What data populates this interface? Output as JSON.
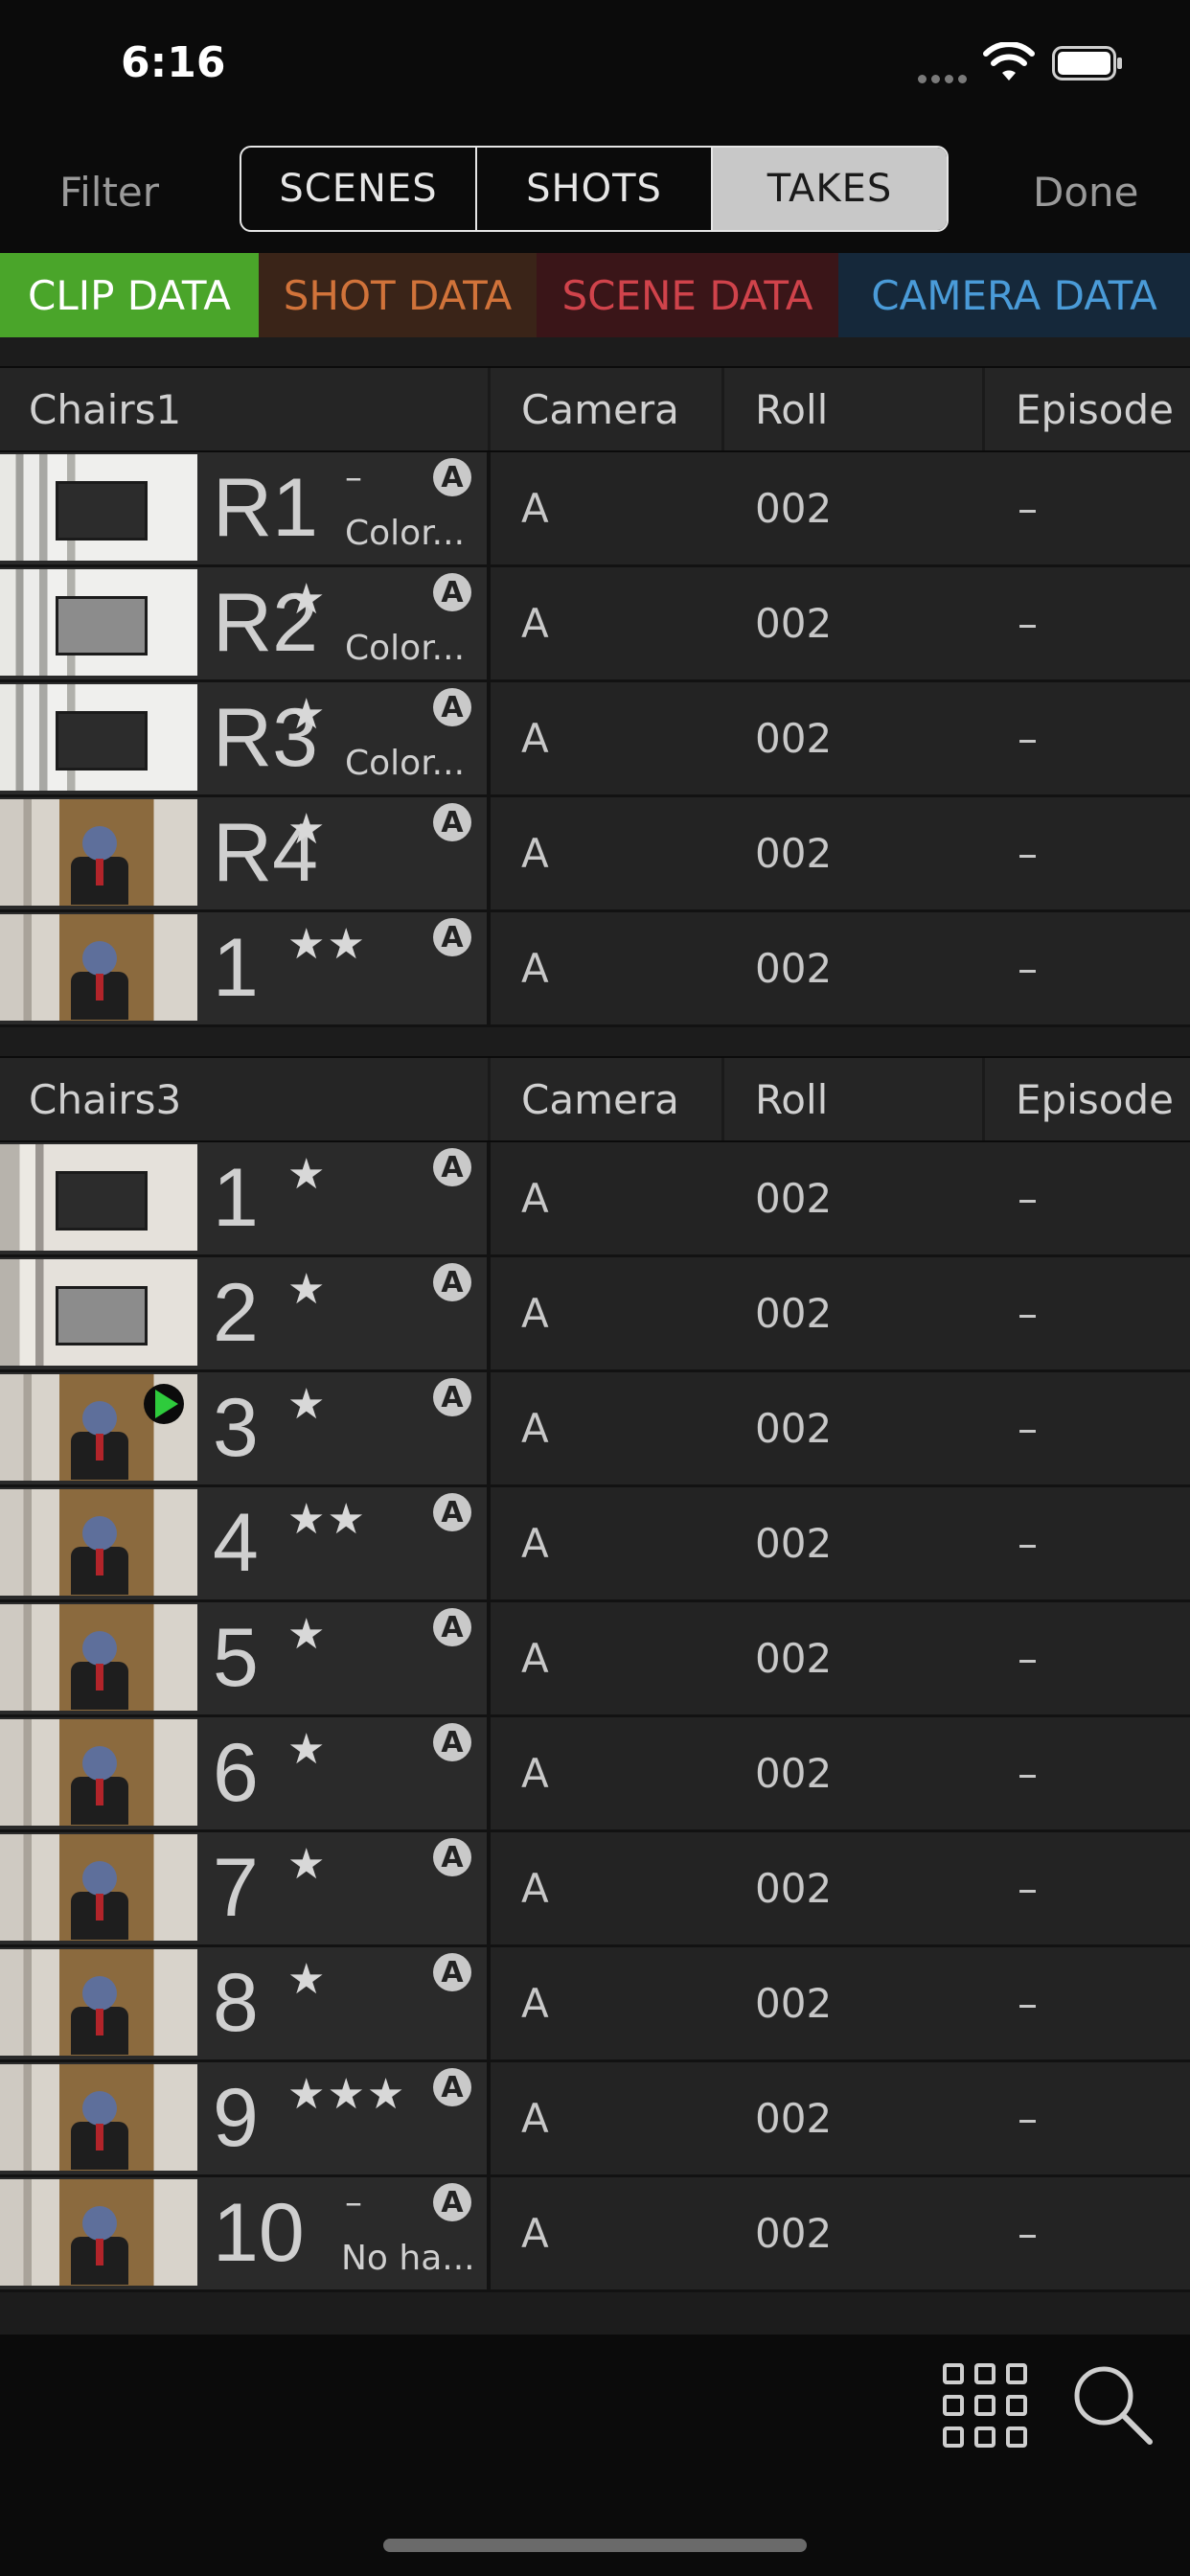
{
  "status": {
    "time": "6:16"
  },
  "nav": {
    "filter": "Filter",
    "done": "Done",
    "segments": [
      "SCENES",
      "SHOTS",
      "TAKES"
    ],
    "active_segment": "TAKES"
  },
  "data_tabs": [
    "CLIP DATA",
    "SHOT DATA",
    "SCENE DATA",
    "CAMERA DATA"
  ],
  "columns": {
    "camera": "Camera",
    "roll": "Roll",
    "episode": "Episode"
  },
  "groups": [
    {
      "name": "Chairs1",
      "takes": [
        {
          "take": "R1",
          "stars": "",
          "dash": "–",
          "note": "Color...",
          "badge": "A",
          "camera": "A",
          "roll": "002",
          "episode": "–"
        },
        {
          "take": "R2",
          "stars": "★",
          "dash": "",
          "note": "Color...",
          "badge": "A",
          "camera": "A",
          "roll": "002",
          "episode": "–"
        },
        {
          "take": "R3",
          "stars": "★",
          "dash": "",
          "note": "Color...",
          "badge": "A",
          "camera": "A",
          "roll": "002",
          "episode": "–"
        },
        {
          "take": "R4",
          "stars": "★",
          "dash": "",
          "note": "",
          "badge": "A",
          "camera": "A",
          "roll": "002",
          "episode": "–"
        },
        {
          "take": "1",
          "stars": "★★",
          "dash": "",
          "note": "",
          "badge": "A",
          "camera": "A",
          "roll": "002",
          "episode": "–"
        }
      ]
    },
    {
      "name": "Chairs3",
      "takes": [
        {
          "take": "1",
          "stars": "★",
          "dash": "",
          "note": "",
          "badge": "A",
          "camera": "A",
          "roll": "002",
          "episode": "–"
        },
        {
          "take": "2",
          "stars": "★",
          "dash": "",
          "note": "",
          "badge": "A",
          "camera": "A",
          "roll": "002",
          "episode": "–"
        },
        {
          "take": "3",
          "stars": "★",
          "dash": "",
          "note": "",
          "badge": "A",
          "camera": "A",
          "roll": "002",
          "episode": "–"
        },
        {
          "take": "4",
          "stars": "★★",
          "dash": "",
          "note": "",
          "badge": "A",
          "camera": "A",
          "roll": "002",
          "episode": "–"
        },
        {
          "take": "5",
          "stars": "★",
          "dash": "",
          "note": "",
          "badge": "A",
          "camera": "A",
          "roll": "002",
          "episode": "–"
        },
        {
          "take": "6",
          "stars": "★",
          "dash": "",
          "note": "",
          "badge": "A",
          "camera": "A",
          "roll": "002",
          "episode": "–"
        },
        {
          "take": "7",
          "stars": "★",
          "dash": "",
          "note": "",
          "badge": "A",
          "camera": "A",
          "roll": "002",
          "episode": "–"
        },
        {
          "take": "8",
          "stars": "★",
          "dash": "",
          "note": "",
          "badge": "A",
          "camera": "A",
          "roll": "002",
          "episode": "–"
        },
        {
          "take": "9",
          "stars": "★★★",
          "dash": "",
          "note": "",
          "badge": "A",
          "camera": "A",
          "roll": "002",
          "episode": "–"
        },
        {
          "take": "10",
          "stars": "",
          "dash": "–",
          "note": "No ha...",
          "badge": "A",
          "camera": "A",
          "roll": "002",
          "episode": "–"
        }
      ]
    }
  ],
  "colors": {
    "clip_tab": "#4aa52a",
    "shot_tab_text": "#d1733a",
    "scene_tab_text": "#d0434b",
    "camera_tab_text": "#4a9bd8",
    "play_badge": "#2ecb3c"
  },
  "icons": {
    "wifi": "wifi-icon",
    "battery": "battery-icon",
    "grid": "grid-icon",
    "search": "search-icon",
    "play": "play-icon"
  }
}
